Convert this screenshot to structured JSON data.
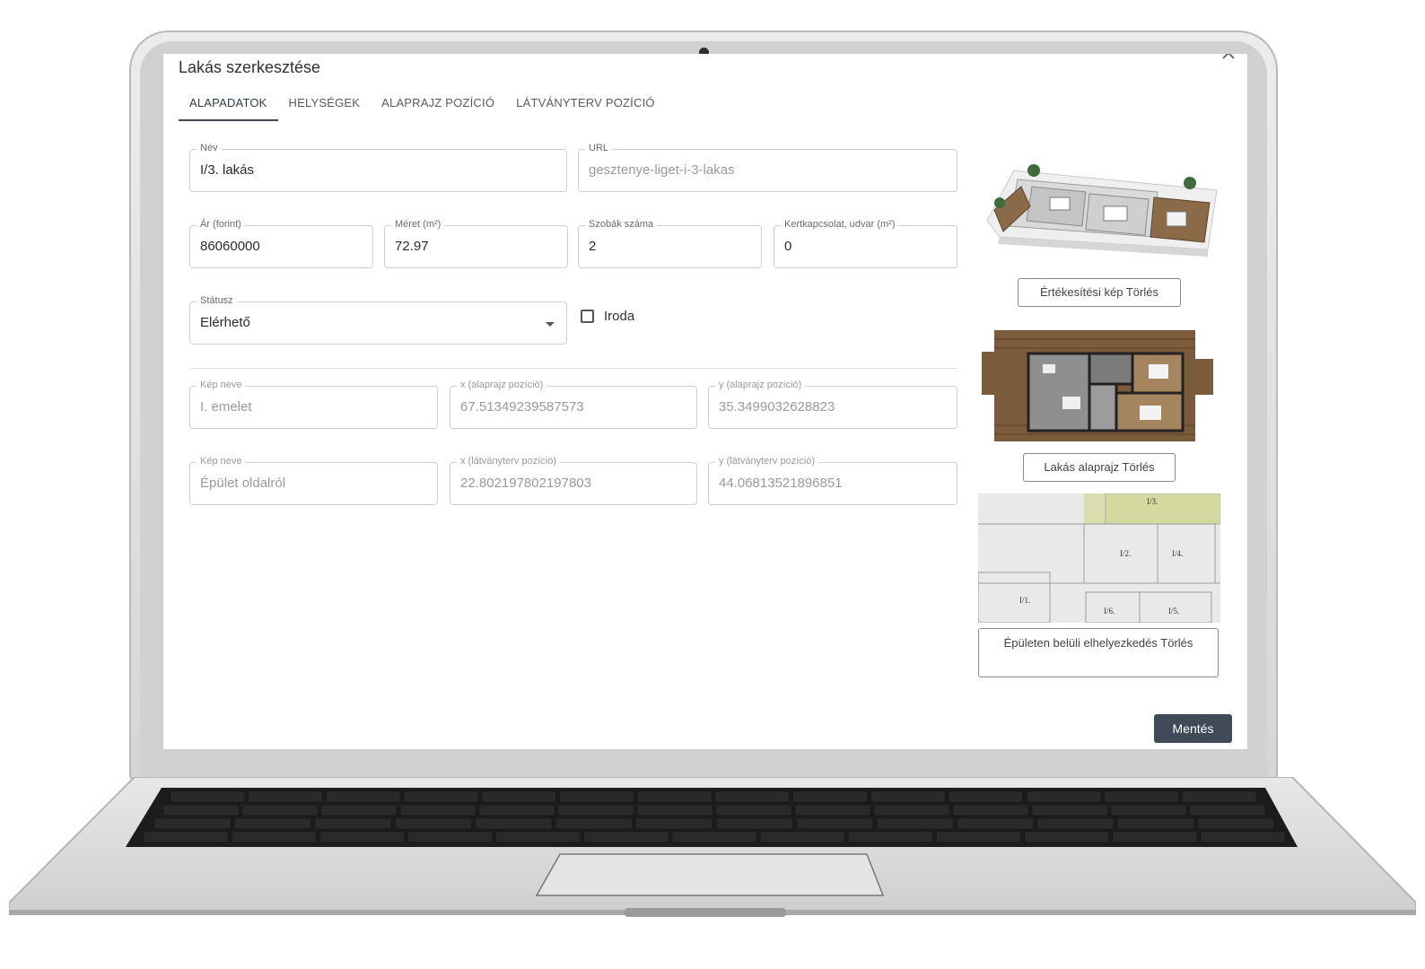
{
  "dialog": {
    "title": "Lakás szerkesztése"
  },
  "tabs": [
    {
      "label": "ALAPADATOK",
      "active": true
    },
    {
      "label": "HELYSÉGEK",
      "active": false
    },
    {
      "label": "ALAPRAJZ POZÍCIÓ",
      "active": false
    },
    {
      "label": "LÁTVÁNYTERV POZÍCIÓ",
      "active": false
    }
  ],
  "fields": {
    "name": {
      "label": "Név",
      "value": "I/3. lakás"
    },
    "url": {
      "label": "URL",
      "value": "gesztenye-liget-i-3-lakas"
    },
    "price": {
      "label": "Ár (forint)",
      "value": "86060000"
    },
    "size": {
      "label": "Méret (m²)",
      "value": "72.97"
    },
    "rooms": {
      "label": "Szobák száma",
      "value": "2"
    },
    "garden": {
      "label": "Kertkapcsolat, udvar (m²)",
      "value": "0"
    },
    "status": {
      "label": "Státusz",
      "value": "Elérhető"
    },
    "office": {
      "label": "Iroda",
      "checked": false
    }
  },
  "floorplan_position": {
    "image_label": "Kép neve",
    "image_value": "I. emelet",
    "x_label": "x (alaprajz pozíció)",
    "x_value": "67.51349239587573",
    "y_label": "y (alaprajz pozíció)",
    "y_value": "35.3499032628823"
  },
  "visual_position": {
    "image_label": "Kép neve",
    "image_value": "Épület oldalról",
    "x_label": "x (látványterv pozíció)",
    "x_value": "22.802197802197803",
    "y_label": "y (látványterv pozíció)",
    "y_value": "44.06813521896851"
  },
  "side_images": {
    "sales_button": "Értékesítési kép Törlés",
    "floorplan_button": "Lakás alaprajz Törlés",
    "location_button": "Épületen belüli elhelyezkedés Törlés",
    "location_labels": [
      "I/3.",
      "I/2.",
      "I/4.",
      "I/1.",
      "I/6.",
      "I/5."
    ]
  },
  "actions": {
    "save": "Mentés"
  },
  "colors": {
    "save_button": "#3f4b58",
    "highlight_unit": "#d9ddb0",
    "field_border": "#cfcfcf"
  }
}
